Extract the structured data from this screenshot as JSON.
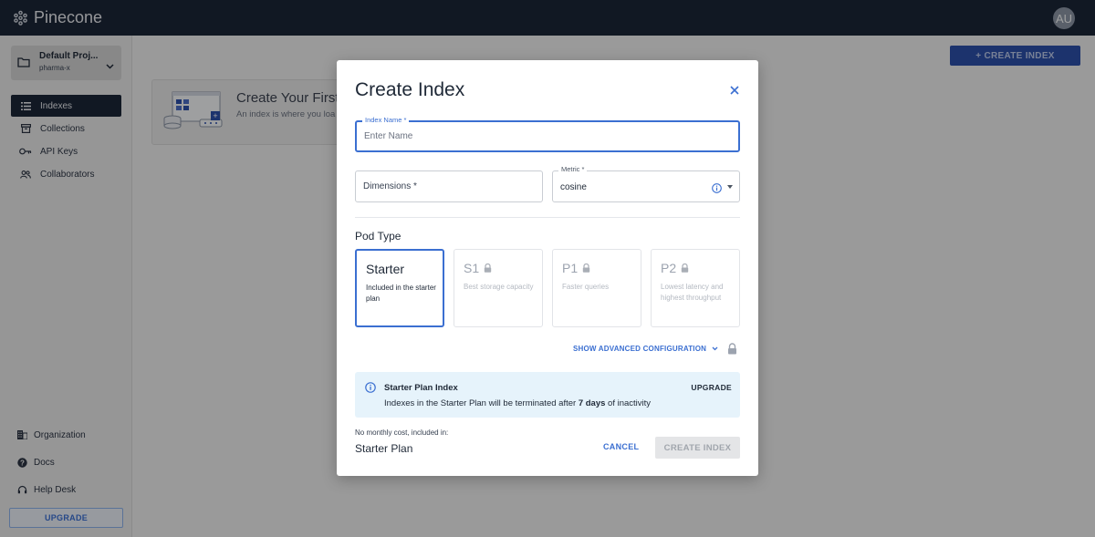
{
  "header": {
    "logo_text": "Pinecone",
    "avatar_initials": "AU"
  },
  "sidebar": {
    "project_name": "Default Proj...",
    "project_sub": "pharma-x",
    "nav": [
      {
        "label": "Indexes",
        "icon": "list-icon",
        "active": true
      },
      {
        "label": "Collections",
        "icon": "archive-icon"
      },
      {
        "label": "API Keys",
        "icon": "key-icon"
      },
      {
        "label": "Collaborators",
        "icon": "users-icon"
      }
    ],
    "bottom_nav": [
      {
        "label": "Organization",
        "icon": "building-icon"
      },
      {
        "label": "Docs",
        "icon": "help-icon"
      },
      {
        "label": "Help Desk",
        "icon": "headset-icon"
      }
    ],
    "upgrade_label": "UPGRADE"
  },
  "main": {
    "create_button": "+ CREATE INDEX",
    "empty_title": "Create Your First",
    "empty_text": "An index is where you loa"
  },
  "modal": {
    "title": "Create Index",
    "index_name": {
      "label": "Index Name *",
      "placeholder": "Enter Name",
      "value": ""
    },
    "dimensions": {
      "label": "Dimensions *"
    },
    "metric": {
      "label": "Metric *",
      "value": "cosine"
    },
    "pod_type_title": "Pod Type",
    "pods": [
      {
        "name": "Starter",
        "desc": "Included in the starter plan",
        "selected": true,
        "locked": false
      },
      {
        "name": "S1",
        "desc": "Best storage capacity",
        "selected": false,
        "locked": true
      },
      {
        "name": "P1",
        "desc": "Faster queries",
        "selected": false,
        "locked": true
      },
      {
        "name": "P2",
        "desc": "Lowest latency and highest throughput",
        "selected": false,
        "locked": true
      }
    ],
    "advanced_label": "SHOW ADVANCED CONFIGURATION",
    "info": {
      "title": "Starter Plan Index",
      "text_before": "Indexes in the Starter Plan will be terminated after ",
      "text_bold": "7 days",
      "text_after": " of inactivity",
      "upgrade": "UPGRADE"
    },
    "cost_note": "No monthly cost, included in:",
    "cost_plan": "Starter Plan",
    "cancel_label": "CANCEL",
    "create_label": "CREATE INDEX"
  },
  "colors": {
    "accent": "#3b6fd1",
    "topbar": "#1b2536",
    "info_bg": "#e6f3fb"
  }
}
